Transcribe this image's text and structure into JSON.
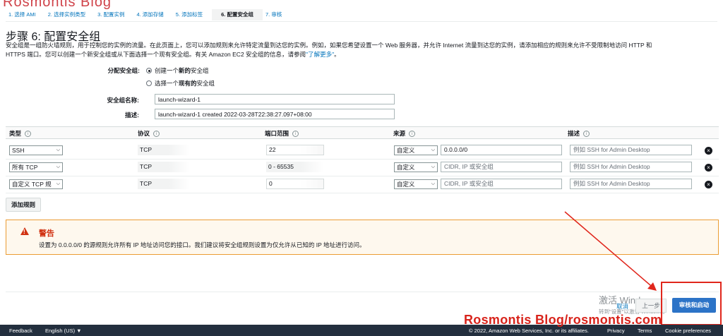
{
  "watermark_top": "Rosmontis Blog",
  "steps": [
    {
      "label": "1. 选择 AMI"
    },
    {
      "label": "2. 选择实例类型"
    },
    {
      "label": "3. 配置实例"
    },
    {
      "label": "4. 添加存储"
    },
    {
      "label": "5. 添加标签"
    },
    {
      "label": "6. 配置安全组"
    },
    {
      "label": "7. 审核"
    }
  ],
  "page": {
    "title": "步骤 6: 配置安全组",
    "description_1": "安全组是一组防火墙规则，用于控制您的实例的流量。在此页面上，您可以添加规则来允许特定流量到达您的实例。例如，如果您希望设置一个 Web 服务器，并允许 Internet 流量到达您的实例，请添加相应的规则来允许不受限制地访问 HTTP 和",
    "description_2": "HTTPS 端口。您可以创建一个新安全组或从下面选择一个现有安全组。有关 Amazon EC2 安全组的信息，请参阅",
    "learn_more": "了解更多",
    "description_end": "。"
  },
  "assign": {
    "label": "分配安全组:",
    "option_new_prefix": "创建一个",
    "option_new_bold": "新的",
    "option_new_suffix": "安全组",
    "option_existing_prefix": "选择一个",
    "option_existing_bold": "现有的",
    "option_existing_suffix": "安全组"
  },
  "group_name": {
    "label": "安全组名称:",
    "value": "launch-wizard-1"
  },
  "group_desc": {
    "label": "描述:",
    "value": "launch-wizard-1 created 2022-03-28T22:38:27.097+08:00"
  },
  "table": {
    "headers": [
      "类型",
      "协议",
      "端口范围",
      "来源",
      "描述"
    ],
    "rows": [
      {
        "type": "SSH",
        "protocol": "TCP",
        "port": "22",
        "source_type": "自定义",
        "source": "0.0.0.0/0",
        "source_placeholder": false,
        "desc_placeholder": "例如 SSH for Admin Desktop"
      },
      {
        "type": "所有 TCP",
        "protocol": "TCP",
        "port": "0 - 65535",
        "source_type": "自定义",
        "source": "CIDR, IP 或安全组",
        "source_placeholder": true,
        "desc_placeholder": "例如 SSH for Admin Desktop"
      },
      {
        "type": "自定义 TCP 规",
        "protocol": "TCP",
        "port": "0",
        "source_type": "自定义",
        "source": "CIDR, IP 或安全组",
        "source_placeholder": true,
        "desc_placeholder": "例如 SSH for Admin Desktop"
      }
    ],
    "info_glyph": "i",
    "delete_glyph": "×"
  },
  "add_rule_label": "添加规则",
  "warning": {
    "title": "警告",
    "text": "设置为 0.0.0.0/0 的源规则允许所有 IP 地址访问您的接口。我们建议将安全组规则设置为仅允许从已知的 IP 地址进行访问。",
    "color": "#d13212"
  },
  "actions": {
    "activate": "激活 Wind",
    "activate_sub": "转到\"设置\"以激活 Windows。",
    "cancel": "取消",
    "previous": "上一步",
    "review_launch": "审核和启动"
  },
  "footer": {
    "feedback": "Feedback",
    "language": "English (US) ▼",
    "copyright": "© 2022, Amazon Web Services, Inc. or its affiliates.",
    "privacy": "Privacy",
    "terms": "Terms",
    "cookie": "Cookie preferences"
  },
  "blog_watermark": "Rosmontis Blog/rosmontis.com",
  "colors": {
    "accent": "#0073bb",
    "primary_button": "#2c73c7",
    "annotation_red": "#e0261c",
    "footer_bg": "#232f3e"
  }
}
